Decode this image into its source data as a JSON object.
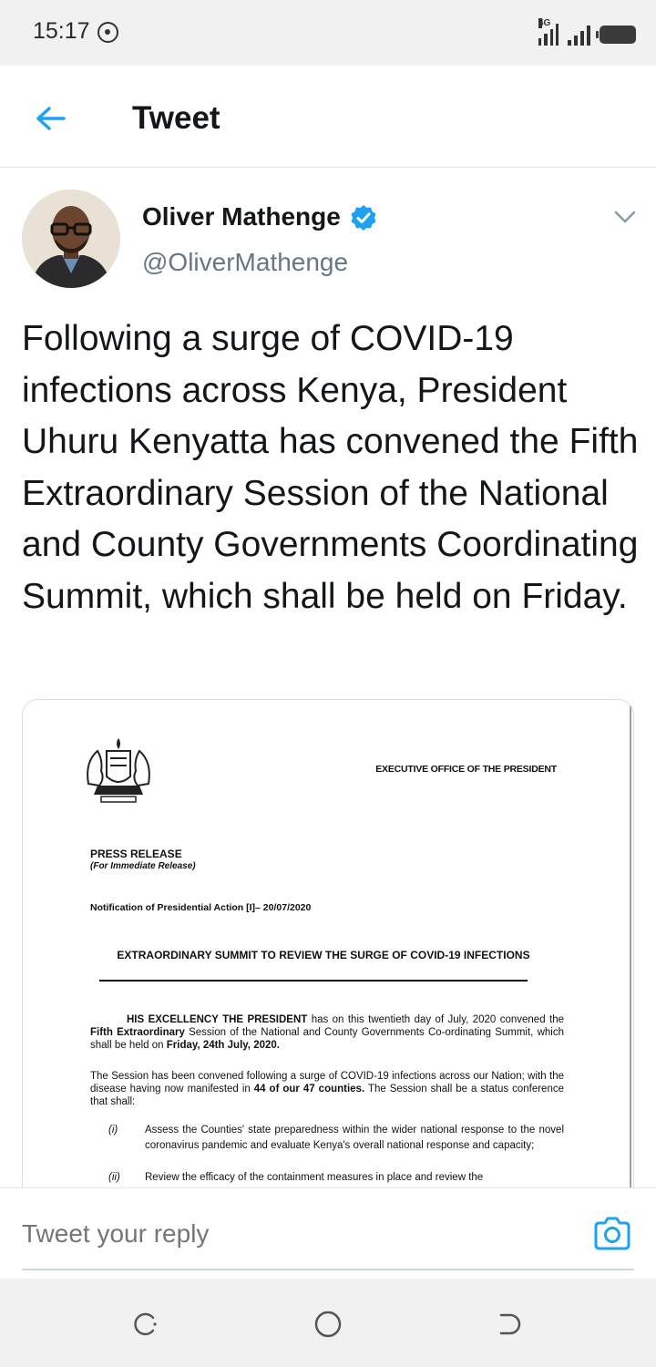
{
  "status_bar": {
    "time": "15:17",
    "network": "4G",
    "icons": [
      "alarm-clock-icon",
      "signal-4g-icon",
      "signal-icon",
      "battery-icon"
    ]
  },
  "header": {
    "title": "Tweet",
    "back_icon": "back-arrow-icon"
  },
  "tweet": {
    "author_name": "Oliver Mathenge",
    "author_handle": "@OliverMathenge",
    "verified": true,
    "text": "Following a surge of COVID-19 infections across Kenya, President Uhuru Kenyatta has convened the Fifth Extraordinary Session of the National and County Governments Coordinating Summit, which shall be held on Friday.",
    "media": {
      "office": "EXECUTIVE OFFICE OF THE PRESIDENT",
      "press_release": "PRESS RELEASE",
      "immediate": "(For Immediate Release)",
      "notification": "Notification of Presidential Action [I]– 20/07/2020",
      "heading": "EXTRAORDINARY SUMMIT TO REVIEW THE SURGE OF COVID-19 INFECTIONS",
      "para1_lead": "HIS EXCELLENCY THE PRESIDENT",
      "para1_mid": " has on this twentieth day of July, 2020 convened the ",
      "para1_bold": "Fifth Extraordinary",
      "para1_rest": " Session of the National and County Governments Co-ordinating Summit, which shall be held on ",
      "para1_date": "Friday, 24th July, 2020.",
      "para2_start": "The Session has been convened following a surge of COVID-19 infections across our Nation; with the disease having now manifested in ",
      "para2_bold": "44 of our 47 counties.",
      "para2_end": " The Session shall be a status conference that shall:",
      "items": [
        {
          "num": "(i)",
          "text": "Assess the Counties' state preparedness within the wider national response to the novel coronavirus pandemic and evaluate Kenya's overall national response and capacity;"
        },
        {
          "num": "(ii)",
          "text": "Review the efficacy of the containment measures in place and review the"
        }
      ]
    }
  },
  "reply": {
    "placeholder": "Tweet your reply",
    "camera_icon": "camera-icon"
  },
  "nav_bar": {
    "icons": [
      "recent-apps-icon",
      "home-icon",
      "back-icon"
    ]
  },
  "colors": {
    "accent": "#1da1f2",
    "text_primary": "#14171a",
    "text_secondary": "#657786",
    "status_bar_bg": "#f1f1f1"
  }
}
